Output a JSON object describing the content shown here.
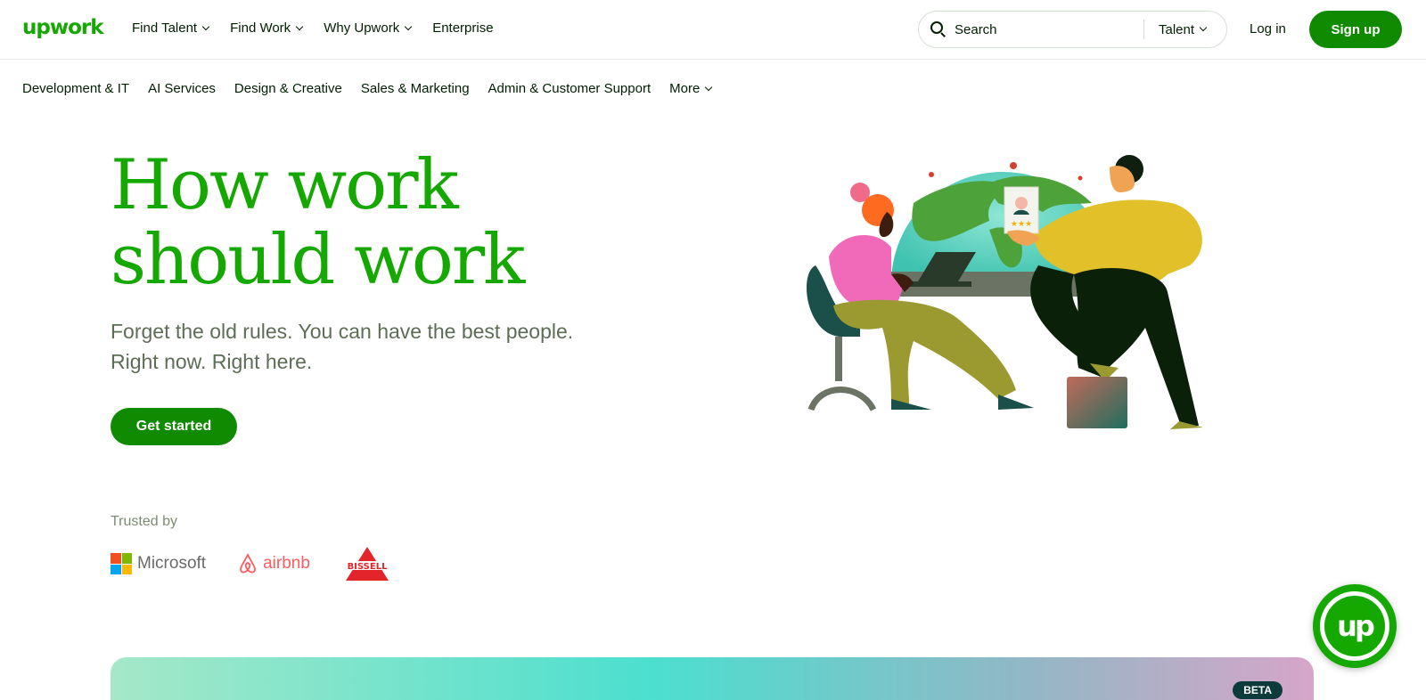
{
  "header": {
    "logo_text": "upwork",
    "nav": [
      {
        "label": "Find Talent",
        "dropdown": true
      },
      {
        "label": "Find Work",
        "dropdown": true
      },
      {
        "label": "Why Upwork",
        "dropdown": true
      },
      {
        "label": "Enterprise",
        "dropdown": false
      }
    ],
    "search": {
      "placeholder": "Search",
      "scope": "Talent"
    },
    "login_label": "Log in",
    "signup_label": "Sign up"
  },
  "categories": [
    "Development & IT",
    "AI Services",
    "Design & Creative",
    "Sales & Marketing",
    "Admin & Customer Support",
    "More"
  ],
  "hero": {
    "title_line1": "How work",
    "title_line2": "should work",
    "subtitle_line1": "Forget the old rules. You can have the best people.",
    "subtitle_line2": "Right now. Right here.",
    "cta_label": "Get started"
  },
  "trusted": {
    "label": "Trusted by",
    "logos": [
      "Microsoft",
      "airbnb",
      "BISSELL"
    ]
  },
  "banner": {
    "badge": "BETA"
  },
  "chat_bubble": {
    "logo_text": "up"
  },
  "colors": {
    "brand_green": "#14a800",
    "button_green": "#108a00",
    "text_dark": "#001e00",
    "subtitle_gray": "#5e6d55"
  }
}
